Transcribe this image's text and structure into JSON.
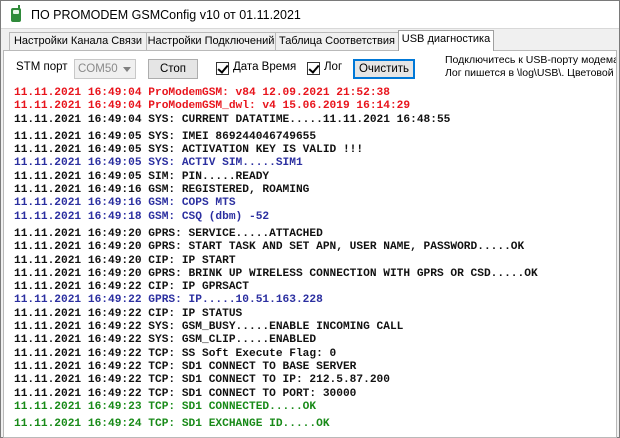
{
  "window": {
    "title": "ПО PROMODEM GSMConfig v10 от 01.11.2021",
    "icon": "phone-icon"
  },
  "tabs": [
    {
      "label": "Настройки Канала Связи"
    },
    {
      "label": "Настройки Подключений"
    },
    {
      "label": "Таблица Соответствия"
    },
    {
      "label": "USB диагностика"
    }
  ],
  "toolbar": {
    "stm_port_label": "STM порт",
    "port_value": "COM50",
    "stop_label": "Стоп",
    "datetime_label": "Дата Время",
    "datetime_checked": true,
    "log_label": "Лог",
    "log_checked": true,
    "clear_label": "Очистить",
    "hint_line1": "Подключитесь к USB-порту модема",
    "hint_line2": "Лог пишется в \\log\\USB\\. Цветовой"
  },
  "colors": {
    "red": "#e8141c",
    "black": "#111111",
    "blue": "#2b2fa0",
    "green": "#188a18",
    "focus": "#0078d7"
  },
  "log_groups": [
    [
      {
        "text": "11.11.2021 16:49:04 ProModemGSM: v84 12.09.2021 21:52:38",
        "color": "red"
      },
      {
        "text": "11.11.2021 16:49:04 ProModemGSM_dwl: v4 15.06.2019 16:14:29",
        "color": "red"
      },
      {
        "text": "11.11.2021 16:49:04 SYS: CURRENT DATATIME.....11.11.2021 16:48:55",
        "color": "black"
      }
    ],
    [
      {
        "text": "11.11.2021 16:49:05 SYS: IMEI 869244046749655",
        "color": "black"
      },
      {
        "text": "11.11.2021 16:49:05 SYS: ACTIVATION KEY IS VALID !!!",
        "color": "black"
      },
      {
        "text": "11.11.2021 16:49:05 SYS: ACTIV SIM.....SIM1",
        "color": "blue"
      },
      {
        "text": "11.11.2021 16:49:05 SIM: PIN.....READY",
        "color": "black"
      },
      {
        "text": "11.11.2021 16:49:16 GSM: REGISTERED, ROAMING",
        "color": "black"
      },
      {
        "text": "11.11.2021 16:49:16 GSM: COPS MTS",
        "color": "blue"
      },
      {
        "text": "11.11.2021 16:49:18 GSM: CSQ (dbm) -52",
        "color": "blue"
      }
    ],
    [
      {
        "text": "11.11.2021 16:49:20 GPRS: SERVICE.....ATTACHED",
        "color": "black"
      },
      {
        "text": "11.11.2021 16:49:20 GPRS: START TASK AND SET APN, USER NAME, PASSWORD.....OK",
        "color": "black"
      },
      {
        "text": "11.11.2021 16:49:20 CIP: IP START",
        "color": "black"
      },
      {
        "text": "11.11.2021 16:49:20 GPRS: BRINK UP WIRELESS CONNECTION WITH GPRS OR CSD.....OK",
        "color": "black"
      },
      {
        "text": "11.11.2021 16:49:22 CIP: IP GPRSACT",
        "color": "black"
      },
      {
        "text": "11.11.2021 16:49:22 GPRS: IP.....10.51.163.228",
        "color": "blue"
      },
      {
        "text": "11.11.2021 16:49:22 CIP: IP STATUS",
        "color": "black"
      },
      {
        "text": "11.11.2021 16:49:22 SYS: GSM_BUSY.....ENABLE INCOMING CALL",
        "color": "black"
      },
      {
        "text": "11.11.2021 16:49:22 SYS: GSM_CLIP.....ENABLED",
        "color": "black"
      },
      {
        "text": "11.11.2021 16:49:22 TCP: SS Soft Execute Flag: 0",
        "color": "black"
      },
      {
        "text": "11.11.2021 16:49:22 TCP: SD1 CONNECT TO BASE SERVER",
        "color": "black"
      },
      {
        "text": "11.11.2021 16:49:22 TCP: SD1 CONNECT TO IP: 212.5.87.200",
        "color": "black"
      },
      {
        "text": "11.11.2021 16:49:22 TCP: SD1 CONNECT TO PORT: 30000",
        "color": "black"
      },
      {
        "text": "11.11.2021 16:49:23 TCP: SD1 CONNECTED.....OK",
        "color": "green"
      }
    ],
    [
      {
        "text": "11.11.2021 16:49:24 TCP: SD1 EXCHANGE ID.....OK",
        "color": "green"
      }
    ]
  ]
}
